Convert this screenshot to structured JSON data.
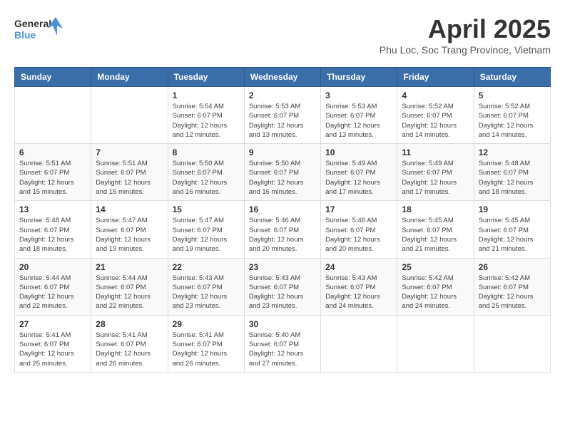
{
  "header": {
    "logo_line1": "General",
    "logo_line2": "Blue",
    "month": "April 2025",
    "location": "Phu Loc, Soc Trang Province, Vietnam"
  },
  "weekdays": [
    "Sunday",
    "Monday",
    "Tuesday",
    "Wednesday",
    "Thursday",
    "Friday",
    "Saturday"
  ],
  "weeks": [
    [
      {
        "day": null,
        "sunrise": null,
        "sunset": null,
        "daylight": null
      },
      {
        "day": null,
        "sunrise": null,
        "sunset": null,
        "daylight": null
      },
      {
        "day": "1",
        "sunrise": "Sunrise: 5:54 AM",
        "sunset": "Sunset: 6:07 PM",
        "daylight": "Daylight: 12 hours and 12 minutes."
      },
      {
        "day": "2",
        "sunrise": "Sunrise: 5:53 AM",
        "sunset": "Sunset: 6:07 PM",
        "daylight": "Daylight: 12 hours and 13 minutes."
      },
      {
        "day": "3",
        "sunrise": "Sunrise: 5:53 AM",
        "sunset": "Sunset: 6:07 PM",
        "daylight": "Daylight: 12 hours and 13 minutes."
      },
      {
        "day": "4",
        "sunrise": "Sunrise: 5:52 AM",
        "sunset": "Sunset: 6:07 PM",
        "daylight": "Daylight: 12 hours and 14 minutes."
      },
      {
        "day": "5",
        "sunrise": "Sunrise: 5:52 AM",
        "sunset": "Sunset: 6:07 PM",
        "daylight": "Daylight: 12 hours and 14 minutes."
      }
    ],
    [
      {
        "day": "6",
        "sunrise": "Sunrise: 5:51 AM",
        "sunset": "Sunset: 6:07 PM",
        "daylight": "Daylight: 12 hours and 15 minutes."
      },
      {
        "day": "7",
        "sunrise": "Sunrise: 5:51 AM",
        "sunset": "Sunset: 6:07 PM",
        "daylight": "Daylight: 12 hours and 15 minutes."
      },
      {
        "day": "8",
        "sunrise": "Sunrise: 5:50 AM",
        "sunset": "Sunset: 6:07 PM",
        "daylight": "Daylight: 12 hours and 16 minutes."
      },
      {
        "day": "9",
        "sunrise": "Sunrise: 5:50 AM",
        "sunset": "Sunset: 6:07 PM",
        "daylight": "Daylight: 12 hours and 16 minutes."
      },
      {
        "day": "10",
        "sunrise": "Sunrise: 5:49 AM",
        "sunset": "Sunset: 6:07 PM",
        "daylight": "Daylight: 12 hours and 17 minutes."
      },
      {
        "day": "11",
        "sunrise": "Sunrise: 5:49 AM",
        "sunset": "Sunset: 6:07 PM",
        "daylight": "Daylight: 12 hours and 17 minutes."
      },
      {
        "day": "12",
        "sunrise": "Sunrise: 5:48 AM",
        "sunset": "Sunset: 6:07 PM",
        "daylight": "Daylight: 12 hours and 18 minutes."
      }
    ],
    [
      {
        "day": "13",
        "sunrise": "Sunrise: 5:48 AM",
        "sunset": "Sunset: 6:07 PM",
        "daylight": "Daylight: 12 hours and 18 minutes."
      },
      {
        "day": "14",
        "sunrise": "Sunrise: 5:47 AM",
        "sunset": "Sunset: 6:07 PM",
        "daylight": "Daylight: 12 hours and 19 minutes."
      },
      {
        "day": "15",
        "sunrise": "Sunrise: 5:47 AM",
        "sunset": "Sunset: 6:07 PM",
        "daylight": "Daylight: 12 hours and 19 minutes."
      },
      {
        "day": "16",
        "sunrise": "Sunrise: 5:46 AM",
        "sunset": "Sunset: 6:07 PM",
        "daylight": "Daylight: 12 hours and 20 minutes."
      },
      {
        "day": "17",
        "sunrise": "Sunrise: 5:46 AM",
        "sunset": "Sunset: 6:07 PM",
        "daylight": "Daylight: 12 hours and 20 minutes."
      },
      {
        "day": "18",
        "sunrise": "Sunrise: 5:45 AM",
        "sunset": "Sunset: 6:07 PM",
        "daylight": "Daylight: 12 hours and 21 minutes."
      },
      {
        "day": "19",
        "sunrise": "Sunrise: 5:45 AM",
        "sunset": "Sunset: 6:07 PM",
        "daylight": "Daylight: 12 hours and 21 minutes."
      }
    ],
    [
      {
        "day": "20",
        "sunrise": "Sunrise: 5:44 AM",
        "sunset": "Sunset: 6:07 PM",
        "daylight": "Daylight: 12 hours and 22 minutes."
      },
      {
        "day": "21",
        "sunrise": "Sunrise: 5:44 AM",
        "sunset": "Sunset: 6:07 PM",
        "daylight": "Daylight: 12 hours and 22 minutes."
      },
      {
        "day": "22",
        "sunrise": "Sunrise: 5:43 AM",
        "sunset": "Sunset: 6:07 PM",
        "daylight": "Daylight: 12 hours and 23 minutes."
      },
      {
        "day": "23",
        "sunrise": "Sunrise: 5:43 AM",
        "sunset": "Sunset: 6:07 PM",
        "daylight": "Daylight: 12 hours and 23 minutes."
      },
      {
        "day": "24",
        "sunrise": "Sunrise: 5:43 AM",
        "sunset": "Sunset: 6:07 PM",
        "daylight": "Daylight: 12 hours and 24 minutes."
      },
      {
        "day": "25",
        "sunrise": "Sunrise: 5:42 AM",
        "sunset": "Sunset: 6:07 PM",
        "daylight": "Daylight: 12 hours and 24 minutes."
      },
      {
        "day": "26",
        "sunrise": "Sunrise: 5:42 AM",
        "sunset": "Sunset: 6:07 PM",
        "daylight": "Daylight: 12 hours and 25 minutes."
      }
    ],
    [
      {
        "day": "27",
        "sunrise": "Sunrise: 5:41 AM",
        "sunset": "Sunset: 6:07 PM",
        "daylight": "Daylight: 12 hours and 25 minutes."
      },
      {
        "day": "28",
        "sunrise": "Sunrise: 5:41 AM",
        "sunset": "Sunset: 6:07 PM",
        "daylight": "Daylight: 12 hours and 26 minutes."
      },
      {
        "day": "29",
        "sunrise": "Sunrise: 5:41 AM",
        "sunset": "Sunset: 6:07 PM",
        "daylight": "Daylight: 12 hours and 26 minutes."
      },
      {
        "day": "30",
        "sunrise": "Sunrise: 5:40 AM",
        "sunset": "Sunset: 6:07 PM",
        "daylight": "Daylight: 12 hours and 27 minutes."
      },
      {
        "day": null,
        "sunrise": null,
        "sunset": null,
        "daylight": null
      },
      {
        "day": null,
        "sunrise": null,
        "sunset": null,
        "daylight": null
      },
      {
        "day": null,
        "sunrise": null,
        "sunset": null,
        "daylight": null
      }
    ]
  ]
}
